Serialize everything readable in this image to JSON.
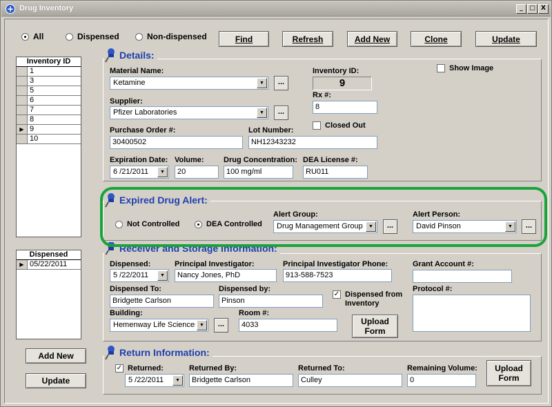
{
  "window": {
    "title": "Drug Inventory",
    "minimize": "_",
    "maximize": "□",
    "close": "X"
  },
  "filter": {
    "all": "All",
    "dispensed": "Dispensed",
    "nondispensed": "Non-dispensed",
    "selected": "All"
  },
  "toolbar": {
    "find": "Find",
    "refresh": "Refresh",
    "add_new": "Add New",
    "clone": "Clone",
    "update": "Update"
  },
  "inventory_list": {
    "header": "Inventory ID",
    "rows": [
      "1",
      "3",
      "5",
      "6",
      "7",
      "8",
      "9",
      "10"
    ],
    "selected": "9"
  },
  "details": {
    "title": "Details:",
    "material_label": "Material Name:",
    "material_value": "Ketamine",
    "supplier_label": "Supplier:",
    "supplier_value": "Pfizer Laboratories",
    "po_label": "Purchase Order #:",
    "po_value": "30400502",
    "lot_label": "Lot Number:",
    "lot_value": "NH12343232",
    "inv_id_label": "Inventory ID:",
    "inv_id_value": "9",
    "rx_label": "Rx #:",
    "rx_value": "8",
    "closed_out": "Closed Out",
    "show_image": "Show Image",
    "exp_label": "Expiration Date:",
    "exp_value": "6 /21/2011",
    "volume_label": "Volume:",
    "volume_value": "20",
    "conc_label": "Drug Concentration:",
    "conc_value": "100 mg/ml",
    "dea_label": "DEA License #:",
    "dea_value": "RU011",
    "ellipsis": "..."
  },
  "alert": {
    "title": "Expired Drug Alert:",
    "not_controlled": "Not Controlled",
    "dea_controlled": "DEA Controlled",
    "selected": "DEA Controlled",
    "group_label": "Alert Group:",
    "group_value": "Drug Management Group",
    "person_label": "Alert Person:",
    "person_value": "David Pinson",
    "highlight_color": "#1aa33a"
  },
  "dispensed_list": {
    "header": "Dispensed",
    "rows": [
      "05/22/2011"
    ]
  },
  "receiver": {
    "title": "Receiver and Storage Information:",
    "dispensed_label": "Dispensed:",
    "dispensed_value": "5 /22/2011",
    "pi_label": "Principal Investigator:",
    "pi_value": "Nancy Jones, PhD",
    "pi_phone_label": "Principal Investigator Phone:",
    "pi_phone_value": "913-588-7523",
    "grant_label": "Grant Account #:",
    "grant_value": "",
    "dispensed_to_label": "Dispensed To:",
    "dispensed_to_value": "Bridgette Carlson",
    "dispensed_by_label": "Dispensed by:",
    "dispensed_by_value": "Pinson",
    "dispensed_from": "Dispensed from Inventory",
    "protocol_label": "Protocol #:",
    "building_label": "Building:",
    "building_value": "Hemenway Life Sciences",
    "room_label": "Room #:",
    "room_value": "4033",
    "upload": "Upload Form"
  },
  "left_buttons": {
    "add_new": "Add New",
    "update": "Update"
  },
  "return_info": {
    "title": "Return Information:",
    "returned_label": "Returned:",
    "returned_value": "5 /22/2011",
    "returned_by_label": "Returned By:",
    "returned_by_value": "Bridgette Carlson",
    "returned_to_label": "Returned To:",
    "returned_to_value": "Culley",
    "remaining_label": "Remaining Volume:",
    "remaining_value": "0",
    "upload": "Upload Form"
  }
}
